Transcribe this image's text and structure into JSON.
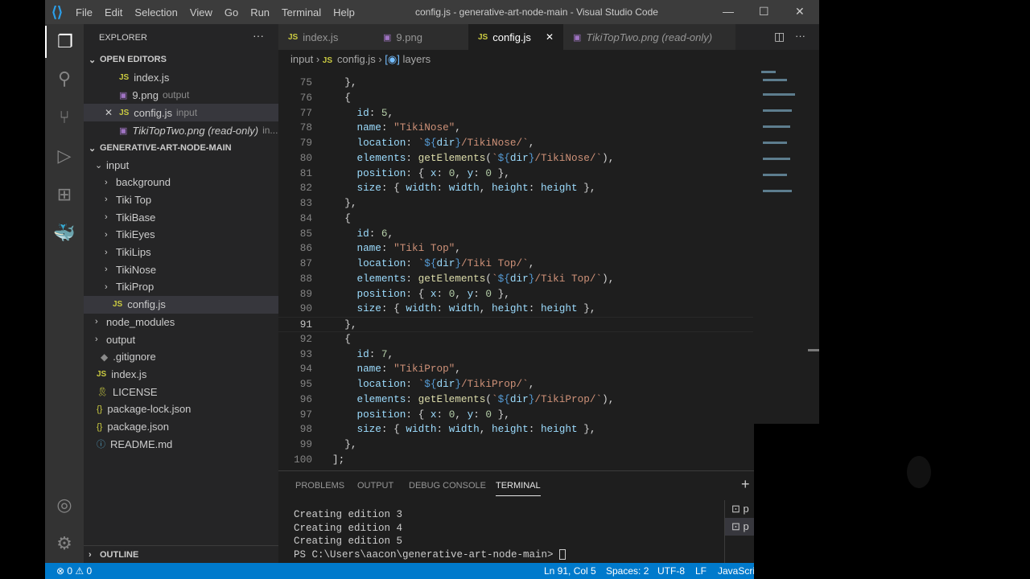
{
  "titlebar": {
    "menu": [
      "File",
      "Edit",
      "Selection",
      "View",
      "Go",
      "Run",
      "Terminal",
      "Help"
    ],
    "title": "config.js - generative-art-node-main - Visual Studio Code"
  },
  "sidebar": {
    "title": "EXPLORER",
    "open_editors_label": "OPEN EDITORS",
    "open_editors": [
      {
        "name": "index.js",
        "type": "js",
        "desc": ""
      },
      {
        "name": "9.png",
        "type": "png",
        "desc": "output"
      },
      {
        "name": "config.js",
        "type": "js",
        "desc": "input",
        "active": true
      },
      {
        "name": "TikiTopTwo.png (read-only)",
        "type": "png",
        "desc": "in..."
      }
    ],
    "project_label": "GENERATIVE-ART-NODE-MAIN",
    "tree": [
      {
        "name": "input",
        "depth": 1,
        "folder": "open"
      },
      {
        "name": "background",
        "depth": 2,
        "folder": "closed"
      },
      {
        "name": "Tiki Top",
        "depth": 2,
        "folder": "closed"
      },
      {
        "name": "TikiBase",
        "depth": 2,
        "folder": "closed"
      },
      {
        "name": "TikiEyes",
        "depth": 2,
        "folder": "closed"
      },
      {
        "name": "TikiLips",
        "depth": 2,
        "folder": "closed"
      },
      {
        "name": "TikiNose",
        "depth": 2,
        "folder": "closed"
      },
      {
        "name": "TikiProp",
        "depth": 2,
        "folder": "closed"
      },
      {
        "name": "config.js",
        "depth": 2,
        "type": "js",
        "selected": true
      },
      {
        "name": "node_modules",
        "depth": 1,
        "folder": "closed"
      },
      {
        "name": "output",
        "depth": 1,
        "folder": "closed"
      },
      {
        "name": ".gitignore",
        "depth": 1,
        "type": "git"
      },
      {
        "name": "index.js",
        "depth": 1,
        "type": "js"
      },
      {
        "name": "LICENSE",
        "depth": 1,
        "type": "license"
      },
      {
        "name": "package-lock.json",
        "depth": 1,
        "type": "json"
      },
      {
        "name": "package.json",
        "depth": 1,
        "type": "json"
      },
      {
        "name": "README.md",
        "depth": 1,
        "type": "info"
      }
    ],
    "outline_label": "OUTLINE"
  },
  "tabs": [
    {
      "name": "index.js",
      "type": "js"
    },
    {
      "name": "9.png",
      "type": "png"
    },
    {
      "name": "config.js",
      "type": "js",
      "active": true
    },
    {
      "name": "TikiTopTwo.png (read-only)",
      "type": "png",
      "italic": true
    }
  ],
  "breadcrumb": [
    "input",
    "config.js",
    "layers"
  ],
  "code": {
    "current_line": 91,
    "lines": [
      {
        "n": 75,
        "t": [
          [
            "p",
            "  },"
          ]
        ]
      },
      {
        "n": 76,
        "t": [
          [
            "p",
            "  {"
          ]
        ]
      },
      {
        "n": 77,
        "t": [
          [
            "k",
            "    id"
          ],
          [
            "p",
            ": "
          ],
          [
            "n",
            "5"
          ],
          [
            "p",
            ","
          ]
        ]
      },
      {
        "n": 78,
        "t": [
          [
            "k",
            "    name"
          ],
          [
            "p",
            ": "
          ],
          [
            "s",
            "\"TikiNose\""
          ],
          [
            "p",
            ","
          ]
        ]
      },
      {
        "n": 79,
        "t": [
          [
            "k",
            "    location"
          ],
          [
            "p",
            ": "
          ],
          [
            "s",
            "`"
          ],
          [
            "b",
            "${"
          ],
          [
            "k",
            "dir"
          ],
          [
            "b",
            "}"
          ],
          [
            "s",
            "/TikiNose/`"
          ],
          [
            "p",
            ","
          ]
        ]
      },
      {
        "n": 80,
        "t": [
          [
            "k",
            "    elements"
          ],
          [
            "p",
            ": "
          ],
          [
            "f",
            "getElements"
          ],
          [
            "p",
            "("
          ],
          [
            "s",
            "`"
          ],
          [
            "b",
            "${"
          ],
          [
            "k",
            "dir"
          ],
          [
            "b",
            "}"
          ],
          [
            "s",
            "/TikiNose/`"
          ],
          [
            "p",
            "),"
          ]
        ]
      },
      {
        "n": 81,
        "t": [
          [
            "k",
            "    position"
          ],
          [
            "p",
            ": { "
          ],
          [
            "k",
            "x"
          ],
          [
            "p",
            ": "
          ],
          [
            "n",
            "0"
          ],
          [
            "p",
            ", "
          ],
          [
            "k",
            "y"
          ],
          [
            "p",
            ": "
          ],
          [
            "n",
            "0"
          ],
          [
            "p",
            " },"
          ]
        ]
      },
      {
        "n": 82,
        "t": [
          [
            "k",
            "    size"
          ],
          [
            "p",
            ": { "
          ],
          [
            "k",
            "width"
          ],
          [
            "p",
            ": "
          ],
          [
            "k",
            "width"
          ],
          [
            "p",
            ", "
          ],
          [
            "k",
            "height"
          ],
          [
            "p",
            ": "
          ],
          [
            "k",
            "height"
          ],
          [
            "p",
            " },"
          ]
        ]
      },
      {
        "n": 83,
        "t": [
          [
            "p",
            "  },"
          ]
        ]
      },
      {
        "n": 84,
        "t": [
          [
            "p",
            "  {"
          ]
        ]
      },
      {
        "n": 85,
        "t": [
          [
            "k",
            "    id"
          ],
          [
            "p",
            ": "
          ],
          [
            "n",
            "6"
          ],
          [
            "p",
            ","
          ]
        ]
      },
      {
        "n": 86,
        "t": [
          [
            "k",
            "    name"
          ],
          [
            "p",
            ": "
          ],
          [
            "s",
            "\"Tiki Top\""
          ],
          [
            "p",
            ","
          ]
        ]
      },
      {
        "n": 87,
        "t": [
          [
            "k",
            "    location"
          ],
          [
            "p",
            ": "
          ],
          [
            "s",
            "`"
          ],
          [
            "b",
            "${"
          ],
          [
            "k",
            "dir"
          ],
          [
            "b",
            "}"
          ],
          [
            "s",
            "/Tiki Top/`"
          ],
          [
            "p",
            ","
          ]
        ]
      },
      {
        "n": 88,
        "t": [
          [
            "k",
            "    elements"
          ],
          [
            "p",
            ": "
          ],
          [
            "f",
            "getElements"
          ],
          [
            "p",
            "("
          ],
          [
            "s",
            "`"
          ],
          [
            "b",
            "${"
          ],
          [
            "k",
            "dir"
          ],
          [
            "b",
            "}"
          ],
          [
            "s",
            "/Tiki Top/`"
          ],
          [
            "p",
            "),"
          ]
        ]
      },
      {
        "n": 89,
        "t": [
          [
            "k",
            "    position"
          ],
          [
            "p",
            ": { "
          ],
          [
            "k",
            "x"
          ],
          [
            "p",
            ": "
          ],
          [
            "n",
            "0"
          ],
          [
            "p",
            ", "
          ],
          [
            "k",
            "y"
          ],
          [
            "p",
            ": "
          ],
          [
            "n",
            "0"
          ],
          [
            "p",
            " },"
          ]
        ]
      },
      {
        "n": 90,
        "t": [
          [
            "k",
            "    size"
          ],
          [
            "p",
            ": { "
          ],
          [
            "k",
            "width"
          ],
          [
            "p",
            ": "
          ],
          [
            "k",
            "width"
          ],
          [
            "p",
            ", "
          ],
          [
            "k",
            "height"
          ],
          [
            "p",
            ": "
          ],
          [
            "k",
            "height"
          ],
          [
            "p",
            " },"
          ]
        ]
      },
      {
        "n": 91,
        "t": [
          [
            "p",
            "  },"
          ]
        ]
      },
      {
        "n": 92,
        "t": [
          [
            "p",
            "  {"
          ]
        ]
      },
      {
        "n": 93,
        "t": [
          [
            "k",
            "    id"
          ],
          [
            "p",
            ": "
          ],
          [
            "n",
            "7"
          ],
          [
            "p",
            ","
          ]
        ]
      },
      {
        "n": 94,
        "t": [
          [
            "k",
            "    name"
          ],
          [
            "p",
            ": "
          ],
          [
            "s",
            "\"TikiProp\""
          ],
          [
            "p",
            ","
          ]
        ]
      },
      {
        "n": 95,
        "t": [
          [
            "k",
            "    location"
          ],
          [
            "p",
            ": "
          ],
          [
            "s",
            "`"
          ],
          [
            "b",
            "${"
          ],
          [
            "k",
            "dir"
          ],
          [
            "b",
            "}"
          ],
          [
            "s",
            "/TikiProp/`"
          ],
          [
            "p",
            ","
          ]
        ]
      },
      {
        "n": 96,
        "t": [
          [
            "k",
            "    elements"
          ],
          [
            "p",
            ": "
          ],
          [
            "f",
            "getElements"
          ],
          [
            "p",
            "("
          ],
          [
            "s",
            "`"
          ],
          [
            "b",
            "${"
          ],
          [
            "k",
            "dir"
          ],
          [
            "b",
            "}"
          ],
          [
            "s",
            "/TikiProp/`"
          ],
          [
            "p",
            "),"
          ]
        ]
      },
      {
        "n": 97,
        "t": [
          [
            "k",
            "    position"
          ],
          [
            "p",
            ": { "
          ],
          [
            "k",
            "x"
          ],
          [
            "p",
            ": "
          ],
          [
            "n",
            "0"
          ],
          [
            "p",
            ", "
          ],
          [
            "k",
            "y"
          ],
          [
            "p",
            ": "
          ],
          [
            "n",
            "0"
          ],
          [
            "p",
            " },"
          ]
        ]
      },
      {
        "n": 98,
        "t": [
          [
            "k",
            "    size"
          ],
          [
            "p",
            ": { "
          ],
          [
            "k",
            "width"
          ],
          [
            "p",
            ": "
          ],
          [
            "k",
            "width"
          ],
          [
            "p",
            ", "
          ],
          [
            "k",
            "height"
          ],
          [
            "p",
            ": "
          ],
          [
            "k",
            "height"
          ],
          [
            "p",
            " },"
          ]
        ]
      },
      {
        "n": 99,
        "t": [
          [
            "p",
            "  },"
          ]
        ]
      },
      {
        "n": 100,
        "t": [
          [
            "p",
            "];"
          ]
        ]
      }
    ]
  },
  "panel": {
    "tabs": [
      "PROBLEMS",
      "OUTPUT",
      "DEBUG CONSOLE",
      "TERMINAL"
    ],
    "active_tab": "TERMINAL",
    "terminal_lines": [
      "Creating edition 3",
      "Creating edition 4",
      "Creating edition 5",
      "PS C:\\Users\\aacon\\generative-art-node-main> "
    ],
    "terminal_instances": [
      "p",
      "p"
    ]
  },
  "status": {
    "errors": "0",
    "warnings": "0",
    "position": "Ln 91, Col 5",
    "spaces": "Spaces: 2",
    "encoding": "UTF-8",
    "eol": "LF",
    "language": "JavaScript"
  },
  "colors": {
    "statusbar": "#007acc",
    "activity": "#333333",
    "sidebar": "#252526",
    "editor": "#1e1e1e"
  }
}
